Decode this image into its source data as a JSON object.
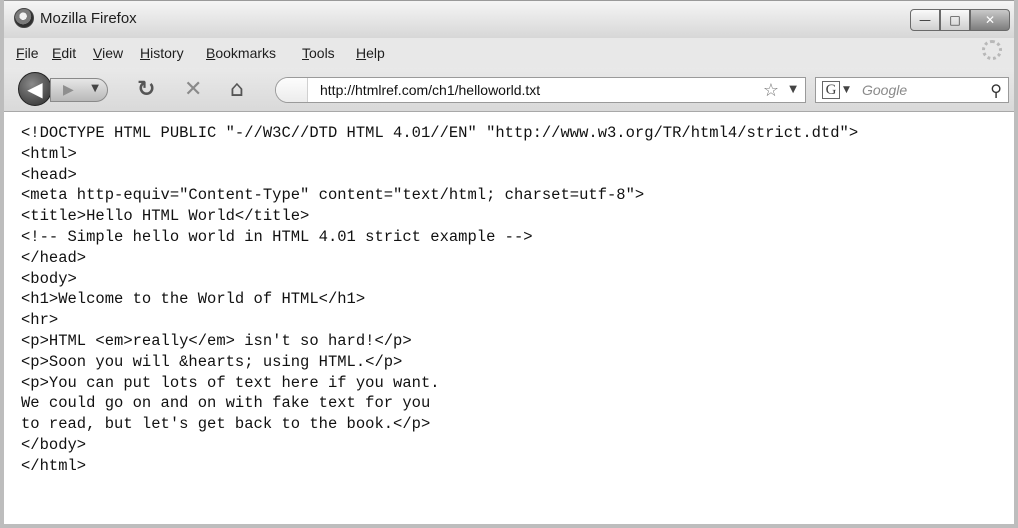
{
  "window": {
    "title": "Mozilla Firefox",
    "buttons": {
      "minimize": "—",
      "maximize": "□",
      "close": "✕"
    }
  },
  "menu": [
    {
      "label": "File"
    },
    {
      "label": "Edit"
    },
    {
      "label": "View"
    },
    {
      "label": "History"
    },
    {
      "label": "Bookmarks"
    },
    {
      "label": "Tools"
    },
    {
      "label": "Help"
    }
  ],
  "toolbar": {
    "back_icon": "back-arrow-icon",
    "forward_icon": "forward-arrow-icon",
    "reload_icon": "reload-icon",
    "stop_icon": "stop-icon",
    "home_icon": "home-icon",
    "url": "http://htmlref.com/ch1/helloworld.txt",
    "bookmark_icon": "star-icon",
    "search_engine": "Google",
    "search_placeholder": "Google"
  },
  "content": {
    "lines": [
      "<!DOCTYPE HTML PUBLIC \"-//W3C//DTD HTML 4.01//EN\" \"http://www.w3.org/TR/html4/strict.dtd\">",
      "<html>",
      "<head>",
      "<meta http-equiv=\"Content-Type\" content=\"text/html; charset=utf-8\">",
      "<title>Hello HTML World</title>",
      "<!-- Simple hello world in HTML 4.01 strict example -->",
      "</head>",
      "<body>",
      "<h1>Welcome to the World of HTML</h1>",
      "<hr>",
      "<p>HTML <em>really</em> isn't so hard!</p>",
      "<p>Soon you will &hearts; using HTML.</p>",
      "<p>You can put lots of text here if you want.",
      "We could go on and on with fake text for you",
      "to read, but let's get back to the book.</p>",
      "</body>",
      "</html>"
    ]
  }
}
